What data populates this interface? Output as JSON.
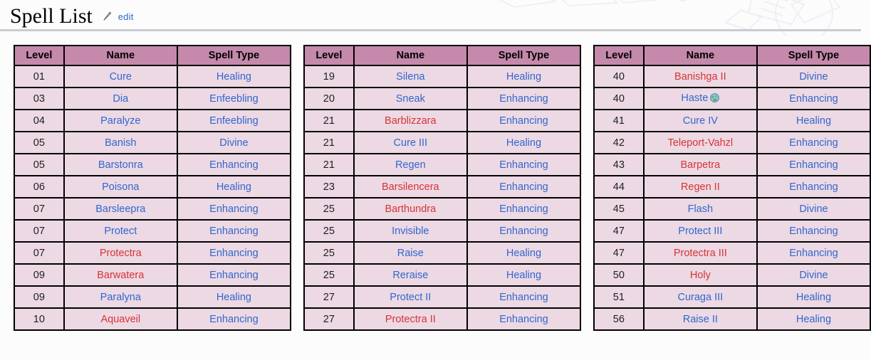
{
  "header": {
    "title": "Spell List",
    "edit_label": "edit",
    "edit_icon": "pencil-icon"
  },
  "table_columns": [
    "Level",
    "Name",
    "Spell Type"
  ],
  "tables": [
    {
      "id": "table-1",
      "rows": [
        {
          "level": "01",
          "name": "Cure",
          "name_state": "blue",
          "type": "Healing",
          "type_state": "blue"
        },
        {
          "level": "03",
          "name": "Dia",
          "name_state": "blue",
          "type": "Enfeebling",
          "type_state": "blue"
        },
        {
          "level": "04",
          "name": "Paralyze",
          "name_state": "blue",
          "type": "Enfeebling",
          "type_state": "blue"
        },
        {
          "level": "05",
          "name": "Banish",
          "name_state": "blue",
          "type": "Divine",
          "type_state": "blue"
        },
        {
          "level": "05",
          "name": "Barstonra",
          "name_state": "blue",
          "type": "Enhancing",
          "type_state": "blue"
        },
        {
          "level": "06",
          "name": "Poisona",
          "name_state": "blue",
          "type": "Healing",
          "type_state": "blue"
        },
        {
          "level": "07",
          "name": "Barsleepra",
          "name_state": "blue",
          "type": "Enhancing",
          "type_state": "blue"
        },
        {
          "level": "07",
          "name": "Protect",
          "name_state": "blue",
          "type": "Enhancing",
          "type_state": "blue"
        },
        {
          "level": "07",
          "name": "Protectra",
          "name_state": "red",
          "type": "Enhancing",
          "type_state": "blue"
        },
        {
          "level": "09",
          "name": "Barwatera",
          "name_state": "red",
          "type": "Enhancing",
          "type_state": "blue"
        },
        {
          "level": "09",
          "name": "Paralyna",
          "name_state": "blue",
          "type": "Healing",
          "type_state": "blue"
        },
        {
          "level": "10",
          "name": "Aquaveil",
          "name_state": "red",
          "type": "Enhancing",
          "type_state": "blue"
        }
      ]
    },
    {
      "id": "table-2",
      "rows": [
        {
          "level": "19",
          "name": "Silena",
          "name_state": "blue",
          "type": "Healing",
          "type_state": "blue"
        },
        {
          "level": "20",
          "name": "Sneak",
          "name_state": "blue",
          "type": "Enhancing",
          "type_state": "blue"
        },
        {
          "level": "21",
          "name": "Barblizzara",
          "name_state": "red",
          "type": "Enhancing",
          "type_state": "blue"
        },
        {
          "level": "21",
          "name": "Cure III",
          "name_state": "blue",
          "type": "Healing",
          "type_state": "blue"
        },
        {
          "level": "21",
          "name": "Regen",
          "name_state": "blue",
          "type": "Enhancing",
          "type_state": "blue"
        },
        {
          "level": "23",
          "name": "Barsilencera",
          "name_state": "red",
          "type": "Enhancing",
          "type_state": "blue"
        },
        {
          "level": "25",
          "name": "Barthundra",
          "name_state": "red",
          "type": "Enhancing",
          "type_state": "blue"
        },
        {
          "level": "25",
          "name": "Invisible",
          "name_state": "blue",
          "type": "Enhancing",
          "type_state": "blue"
        },
        {
          "level": "25",
          "name": "Raise",
          "name_state": "blue",
          "type": "Healing",
          "type_state": "blue"
        },
        {
          "level": "25",
          "name": "Reraise",
          "name_state": "blue",
          "type": "Healing",
          "type_state": "blue"
        },
        {
          "level": "27",
          "name": "Protect II",
          "name_state": "blue",
          "type": "Enhancing",
          "type_state": "blue"
        },
        {
          "level": "27",
          "name": "Protectra II",
          "name_state": "red",
          "type": "Enhancing",
          "type_state": "blue"
        }
      ]
    },
    {
      "id": "table-3",
      "rows": [
        {
          "level": "40",
          "name": "Banishga II",
          "name_state": "red",
          "type": "Divine",
          "type_state": "blue"
        },
        {
          "level": "40",
          "name": "Haste",
          "name_state": "blue",
          "type": "Enhancing",
          "type_state": "blue",
          "icon": "globe-icon"
        },
        {
          "level": "41",
          "name": "Cure IV",
          "name_state": "blue",
          "type": "Healing",
          "type_state": "blue"
        },
        {
          "level": "42",
          "name": "Teleport-Vahzl",
          "name_state": "red",
          "type": "Enhancing",
          "type_state": "blue"
        },
        {
          "level": "43",
          "name": "Barpetra",
          "name_state": "red",
          "type": "Enhancing",
          "type_state": "blue"
        },
        {
          "level": "44",
          "name": "Regen II",
          "name_state": "red",
          "type": "Enhancing",
          "type_state": "blue"
        },
        {
          "level": "45",
          "name": "Flash",
          "name_state": "blue",
          "type": "Divine",
          "type_state": "blue"
        },
        {
          "level": "47",
          "name": "Protect III",
          "name_state": "blue",
          "type": "Enhancing",
          "type_state": "blue"
        },
        {
          "level": "47",
          "name": "Protectra III",
          "name_state": "red",
          "type": "Enhancing",
          "type_state": "blue"
        },
        {
          "level": "50",
          "name": "Holy",
          "name_state": "red",
          "type": "Divine",
          "type_state": "blue"
        },
        {
          "level": "51",
          "name": "Curaga III",
          "name_state": "blue",
          "type": "Healing",
          "type_state": "blue"
        },
        {
          "level": "56",
          "name": "Raise II",
          "name_state": "blue",
          "type": "Healing",
          "type_state": "blue"
        }
      ]
    }
  ],
  "colors": {
    "header_bg": "#c489ab",
    "cell_bg": "#ecd9e4",
    "border": "#000000",
    "link_blue": "#3366cc",
    "link_red": "#d73333",
    "page_bg": "#fcfcfc",
    "rule": "#c8ccd1"
  }
}
